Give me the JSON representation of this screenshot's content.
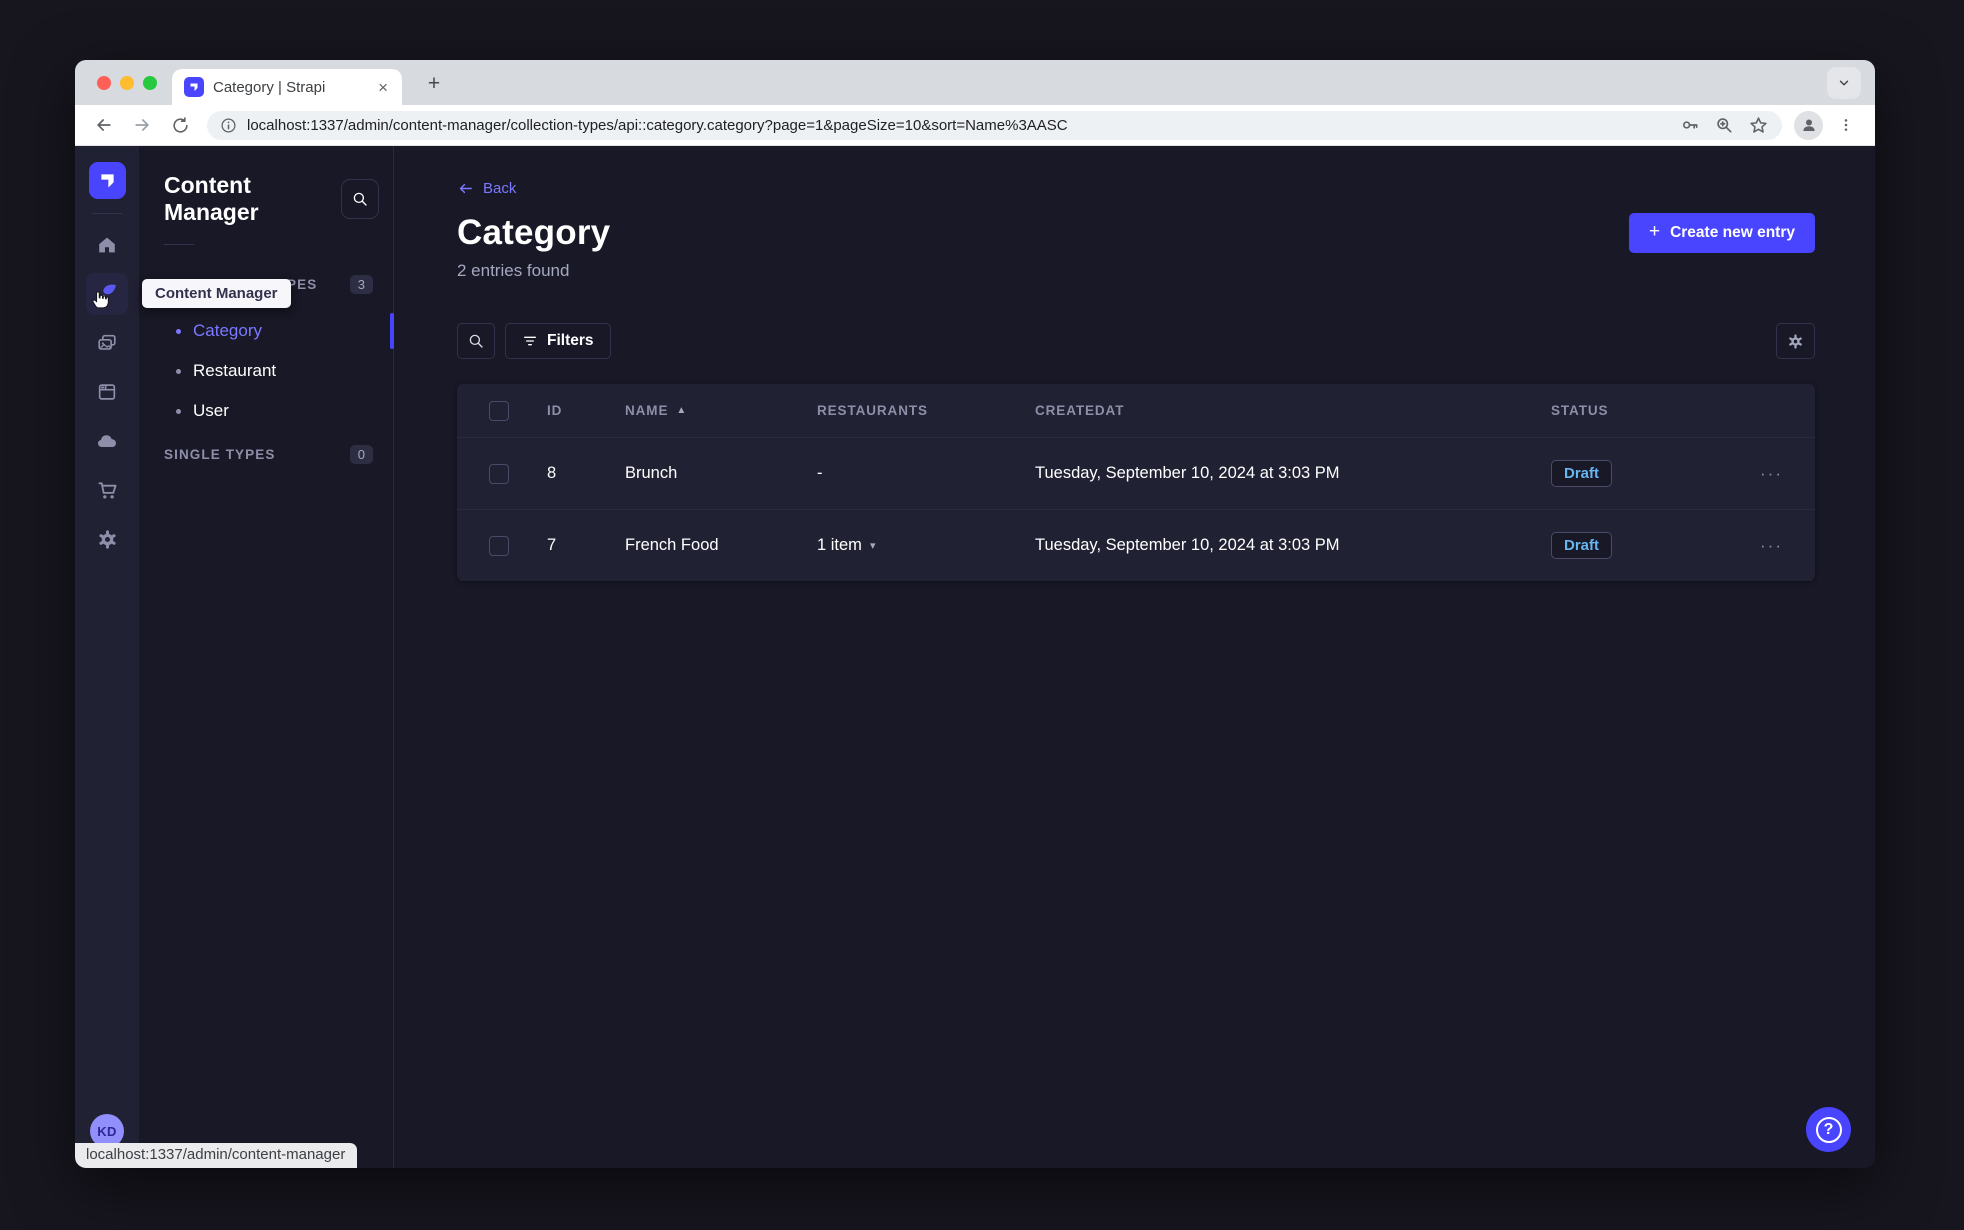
{
  "browser": {
    "tab_title": "Category | Strapi",
    "url": "localhost:1337/admin/content-manager/collection-types/api::category.category?page=1&pageSize=10&sort=Name%3AASC",
    "status_link": "localhost:1337/admin/content-manager"
  },
  "glyphs": {
    "close_tab": "×",
    "new_tab": "+",
    "plus": "+",
    "sort_asc": "▲",
    "chevron_down": "▾",
    "row_actions": "···",
    "help": "?"
  },
  "iconnav": {
    "tooltip": "Content Manager",
    "avatar_initials": "KD"
  },
  "subnav": {
    "title": "Content Manager",
    "collection_types_label": "COLLECTION TYPES",
    "collection_types_count": "3",
    "items": [
      {
        "label": "Category"
      },
      {
        "label": "Restaurant"
      },
      {
        "label": "User"
      }
    ],
    "single_types_label": "SINGLE TYPES",
    "single_types_count": "0"
  },
  "main": {
    "back_label": "Back",
    "title": "Category",
    "entries_found": "2 entries found",
    "create_button_label": "Create new entry",
    "filters_button_label": "Filters"
  },
  "table": {
    "headers": {
      "id": "ID",
      "name": "NAME",
      "restaurants": "RESTAURANTS",
      "createdat": "CREATEDAT",
      "status": "STATUS"
    },
    "rows": [
      {
        "id": "8",
        "name": "Brunch",
        "restaurants": "-",
        "createdat": "Tuesday, September 10, 2024 at 3:03 PM",
        "status": "Draft"
      },
      {
        "id": "7",
        "name": "French Food",
        "restaurants": "1 item",
        "createdat": "Tuesday, September 10, 2024 at 3:03 PM",
        "status": "Draft"
      }
    ]
  },
  "colors": {
    "primary": "#4945ff",
    "primary_text": "#7b79ff",
    "draft_text": "#66b7f1",
    "page_bg": "#181826",
    "panel_bg": "#212134",
    "border": "#32324d"
  }
}
